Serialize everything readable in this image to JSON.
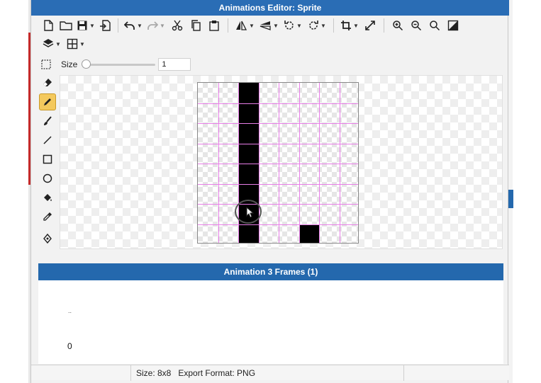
{
  "window": {
    "title": "Animations Editor: Sprite"
  },
  "toolbar": {
    "row1": [
      "new-file-icon",
      "open-folder-icon",
      "save-icon",
      "export-icon",
      "undo-icon",
      "redo-icon",
      "cut-icon",
      "copy-icon",
      "paste-icon",
      "flip-horizontal-icon",
      "flip-vertical-icon",
      "rotate-left-icon",
      "rotate-right-icon",
      "crop-icon",
      "resize-icon",
      "zoom-in-icon",
      "zoom-out-icon",
      "zoom-fit-icon",
      "fill-toggle-icon"
    ],
    "row2": [
      "layers-icon",
      "grid-icon"
    ]
  },
  "size_bar": {
    "label": "Size",
    "value": "1",
    "slider_level": 0.0
  },
  "tools": {
    "items": [
      "eraser",
      "pencil",
      "brush",
      "line",
      "rectangle",
      "circle",
      "fill-bucket",
      "eyedropper",
      "pivot"
    ],
    "active": "pencil"
  },
  "sprite": {
    "columns": 8,
    "rows": 8,
    "filled_cells": [
      {
        "col": 2,
        "row": 0
      },
      {
        "col": 2,
        "row": 1
      },
      {
        "col": 2,
        "row": 2
      },
      {
        "col": 2,
        "row": 3
      },
      {
        "col": 2,
        "row": 4
      },
      {
        "col": 2,
        "row": 5
      },
      {
        "col": 2,
        "row": 6
      },
      {
        "col": 2,
        "row": 7
      },
      {
        "col": 5,
        "row": 7
      }
    ]
  },
  "animation": {
    "header": "Animation 3 Frames (1)",
    "dots": "..",
    "frame_index": "0"
  },
  "status": {
    "text": "Size: 8x8   Export Format: PNG"
  },
  "colors": {
    "titlebar": "#2a6db5",
    "panel_header": "#2468ad",
    "active_tool": "#f4c95d",
    "grid_line": "#e87ee8",
    "pixel": "#000000"
  }
}
